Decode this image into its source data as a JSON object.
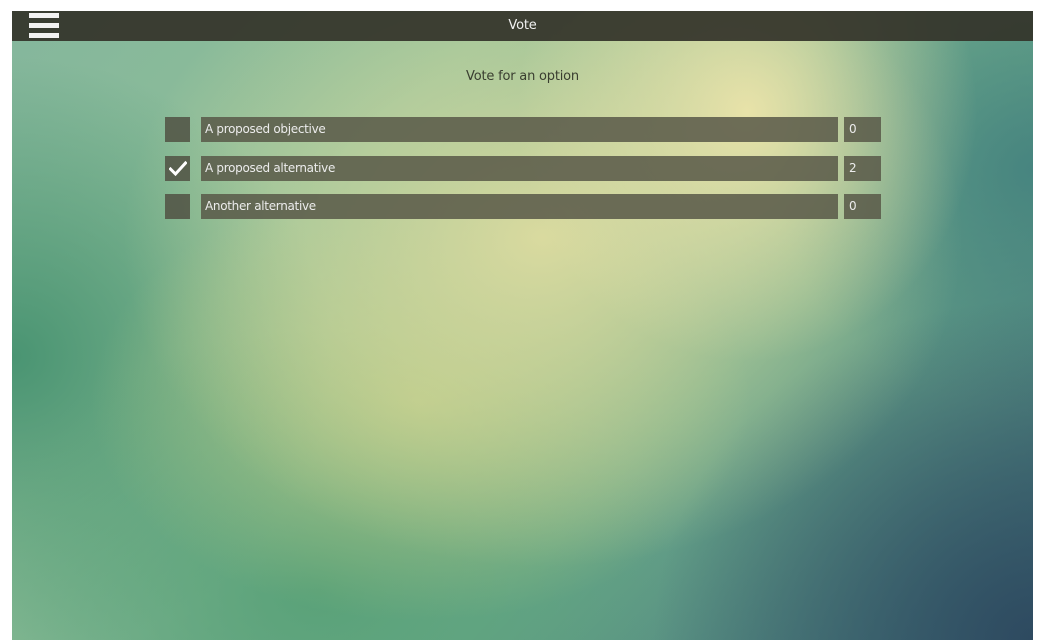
{
  "topbar": {
    "title": "Vote",
    "menu_icon": "hamburger-menu-icon"
  },
  "main": {
    "heading": "Vote for an option",
    "options": [
      {
        "label": "A proposed objective",
        "count": "0",
        "checked": false
      },
      {
        "label": "A proposed alternative",
        "count": "2",
        "checked": true
      },
      {
        "label": "Another alternative",
        "count": "0",
        "checked": false
      }
    ],
    "check_icon": "checkmark-icon"
  },
  "colors": {
    "topbar": "#34342a",
    "row_fill": "#585848",
    "text_light": "#ececec"
  }
}
